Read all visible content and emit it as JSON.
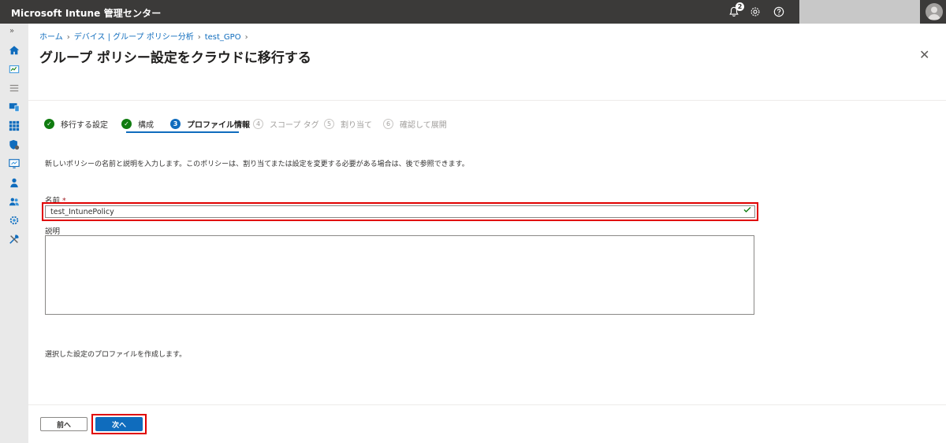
{
  "topbar": {
    "app_title": "Microsoft Intune 管理センター",
    "notification_count": "2"
  },
  "breadcrumb": {
    "items": [
      "ホーム",
      "デバイス | グループ ポリシー分析",
      "test_GPO"
    ]
  },
  "page": {
    "title": "グループ ポリシー設定をクラウドに移行する",
    "more": "···",
    "close": "✕"
  },
  "steps": [
    {
      "number": "✓",
      "label": "移行する設定",
      "state": "done"
    },
    {
      "number": "✓",
      "label": "構成",
      "state": "done"
    },
    {
      "number": "3",
      "label": "プロファイル情報",
      "state": "active"
    },
    {
      "number": "4",
      "label": "スコープ タグ",
      "state": "pending"
    },
    {
      "number": "5",
      "label": "割り当て",
      "state": "pending"
    },
    {
      "number": "6",
      "label": "確認して展開",
      "state": "pending"
    }
  ],
  "form": {
    "description_text": "新しいポリシーの名前と説明を入力します。このポリシーは、割り当てまたは設定を変更する必要がある場合は、後で参照できます。",
    "name_label": "名前",
    "required_mark": "*",
    "name_value": "test_IntunePolicy",
    "desc_label": "説明",
    "desc_value": ""
  },
  "footer": {
    "note": "選択した設定のプロファイルを作成します。",
    "prev_label": "前へ",
    "next_label": "次へ"
  },
  "colors": {
    "topbar": "#3b3a39",
    "accent": "#0f6cbd",
    "success": "#107c10",
    "highlight": "#e00000"
  }
}
